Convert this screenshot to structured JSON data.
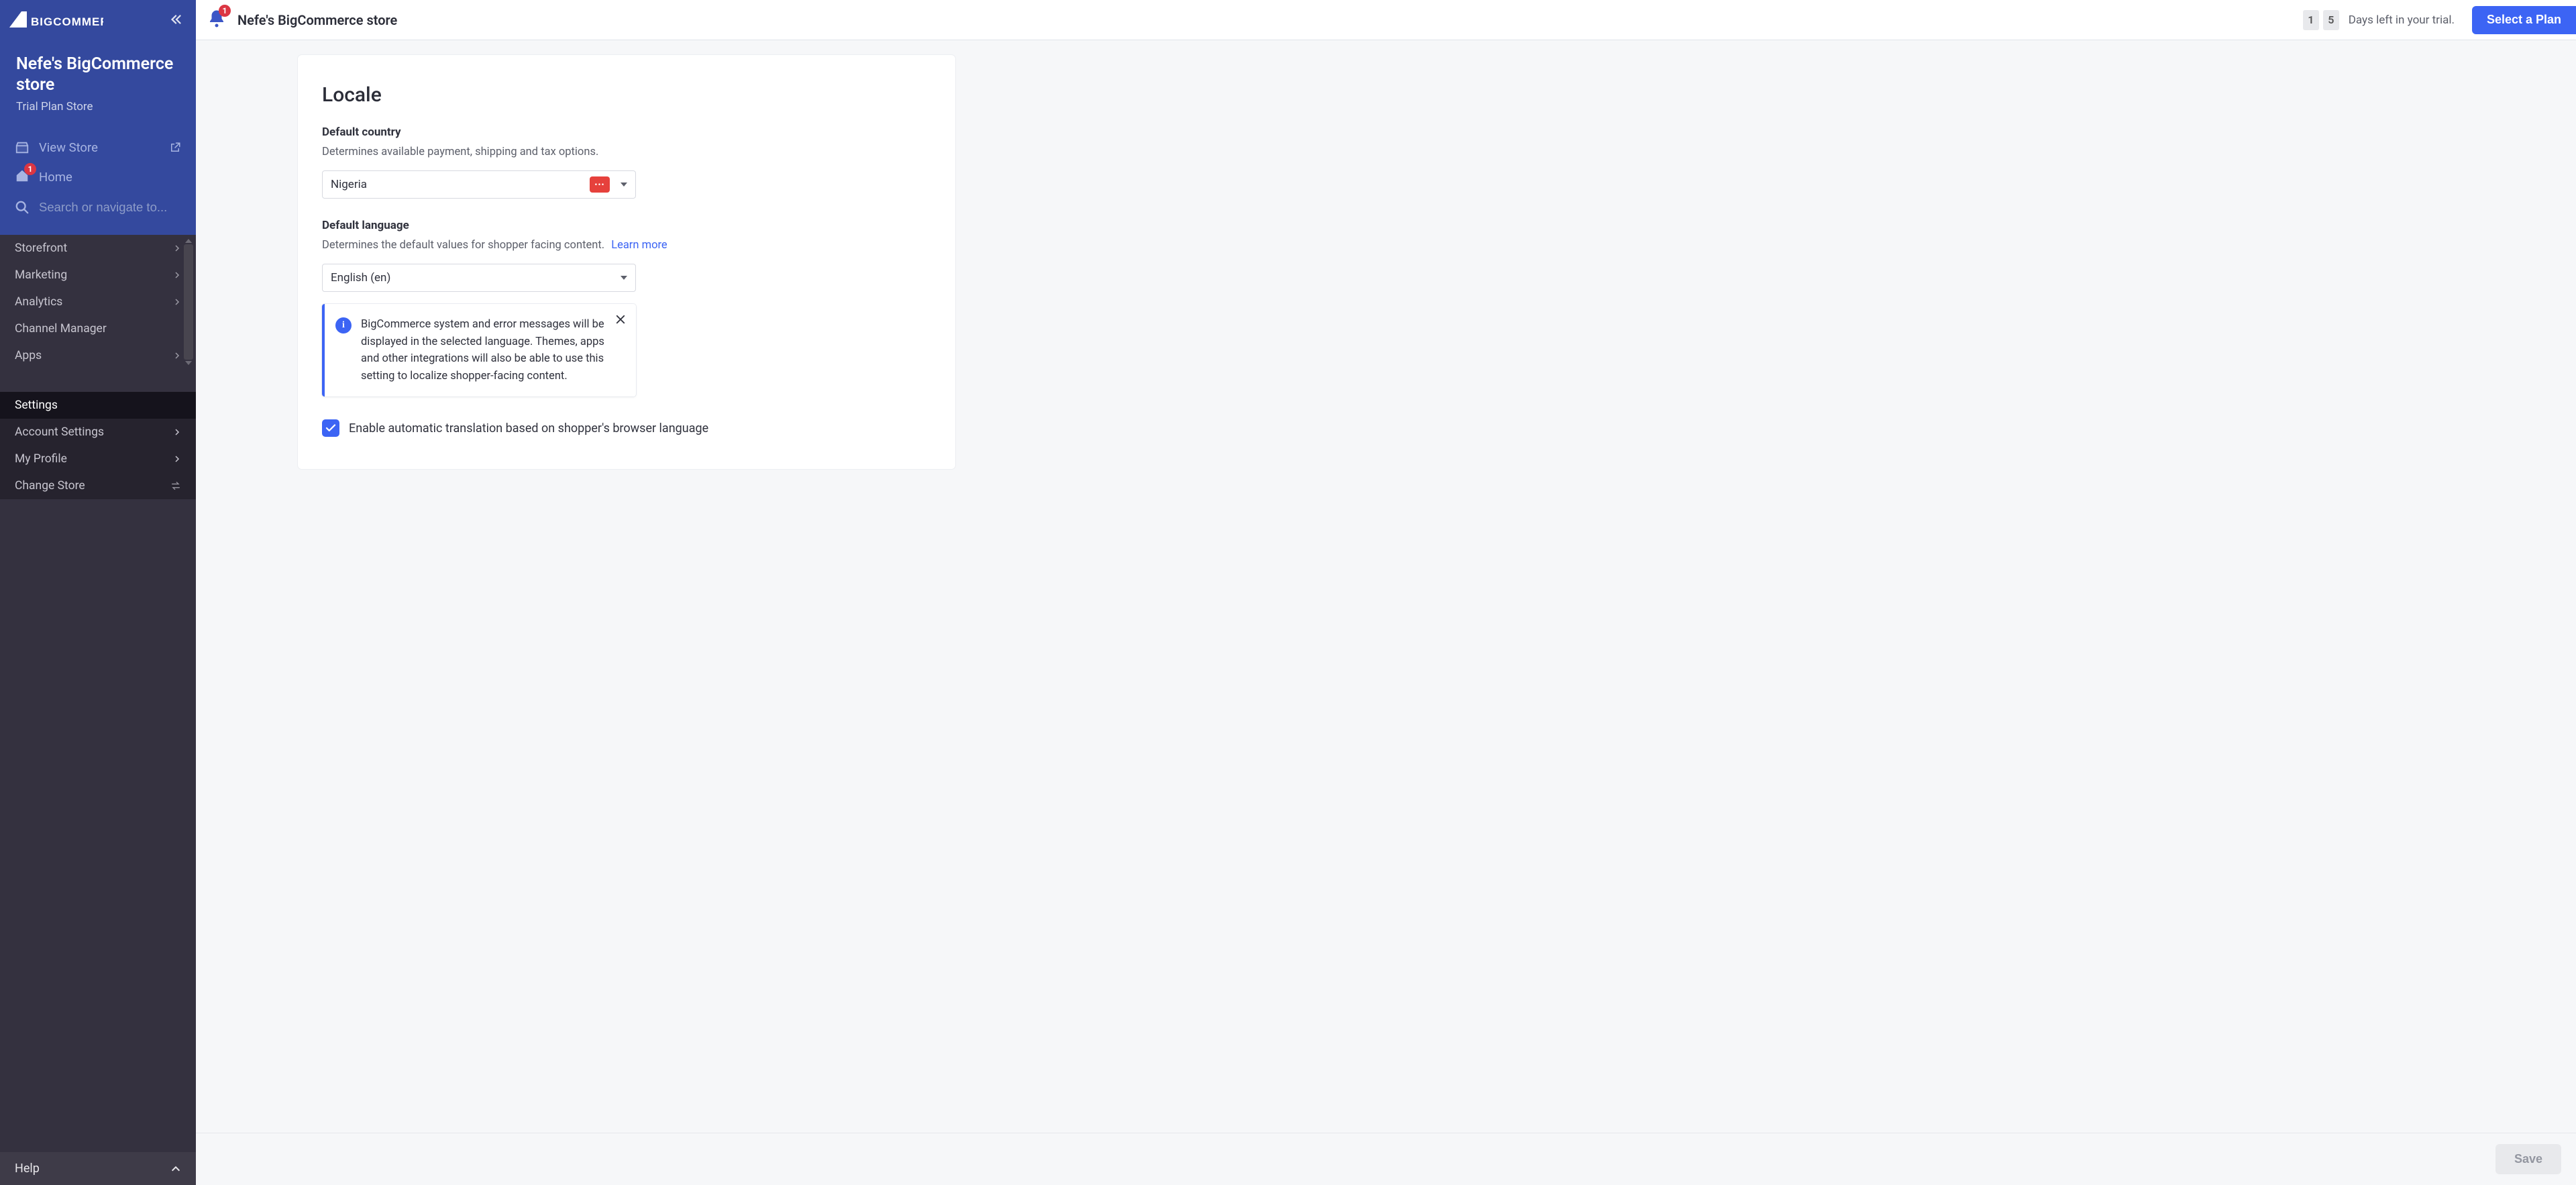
{
  "brand": "BIGCOMMERCE",
  "store": {
    "name": "Nefe's BigCommerce store",
    "plan": "Trial Plan Store"
  },
  "topbar": {
    "title": "Nefe's BigCommerce store",
    "notification_count": "1",
    "trial_digits": [
      "1",
      "5"
    ],
    "trial_text": "Days left in your trial.",
    "select_plan": "Select a Plan"
  },
  "sidebar": {
    "view_store": "View Store",
    "home": "Home",
    "home_badge": "1",
    "search_placeholder": "Search or navigate to...",
    "secondary": [
      "Storefront",
      "Marketing",
      "Analytics",
      "Channel Manager",
      "Apps"
    ],
    "tertiary": [
      "Settings",
      "Account Settings",
      "My Profile",
      "Change Store"
    ],
    "help": "Help"
  },
  "locale": {
    "heading": "Locale",
    "country_label": "Default country",
    "country_help": "Determines available payment, shipping and tax options.",
    "country_value": "Nigeria",
    "language_label": "Default language",
    "language_help": "Determines the default values for shopper facing content.",
    "language_learn_more": "Learn more",
    "language_value": "English (en)",
    "info": "BigCommerce system and error messages will be displayed in the selected language. Themes, apps and other integrations will also be able to use this setting to localize shopper-facing content.",
    "auto_translate": "Enable automatic translation based on shopper's browser language",
    "auto_translate_checked": true
  },
  "footer": {
    "save": "Save"
  }
}
